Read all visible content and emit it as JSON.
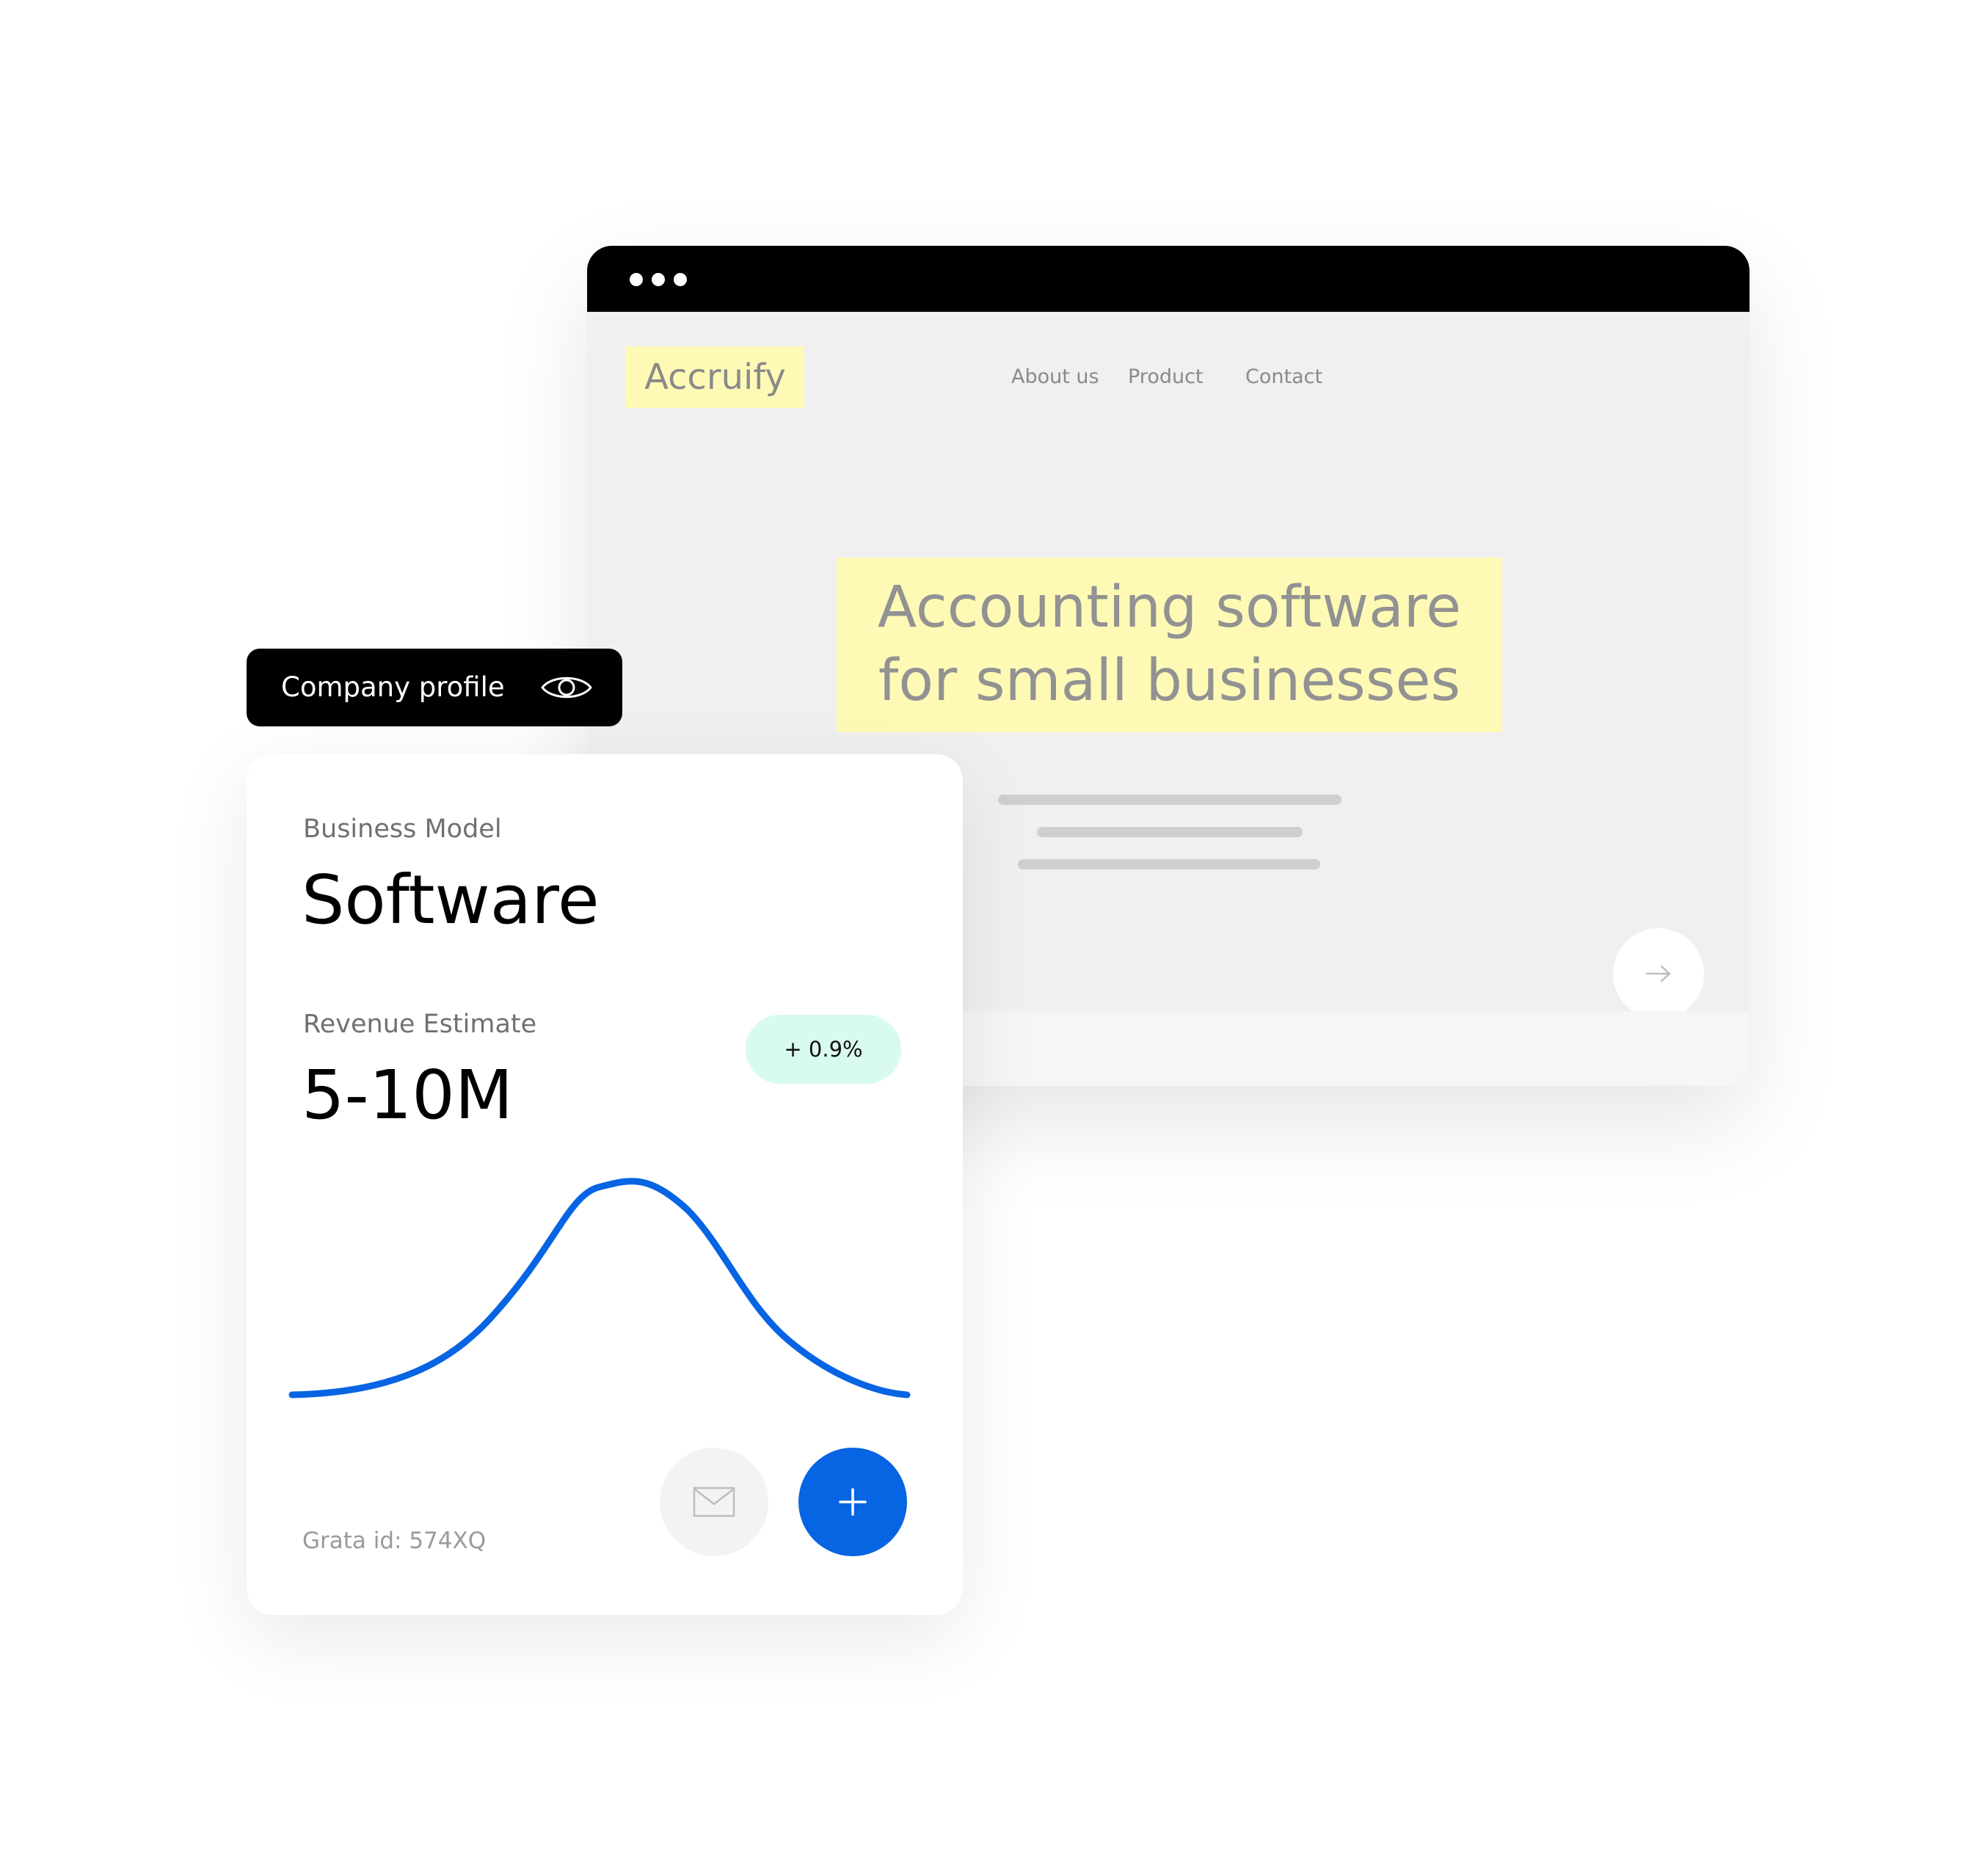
{
  "browser": {
    "logo": "Accruify",
    "nav": {
      "about": "About us",
      "product": "Product",
      "contact": "Contact"
    },
    "hero": {
      "line1": "Accounting software",
      "line2": "for small businesses"
    }
  },
  "profile_pill": {
    "label": "Company profile"
  },
  "card": {
    "business_model_label": "Business Model",
    "business_model_value": "Software",
    "revenue_label": "Revenue Estimate",
    "revenue_value": "5-10M",
    "revenue_change": "+ 0.9%",
    "grata_id": "Grata id: 574XQ"
  },
  "icons": {
    "eye": "eye-icon",
    "arrow": "arrow-right-icon",
    "mail": "mail-icon",
    "plus": "plus-icon"
  },
  "colors": {
    "accent_blue": "#0764e3",
    "highlight_yellow": "#fefab6",
    "badge_mint": "#d9faef",
    "titlebar_black": "#000000"
  }
}
